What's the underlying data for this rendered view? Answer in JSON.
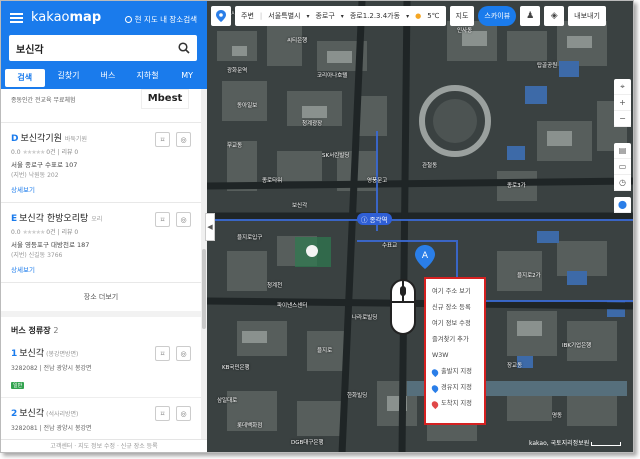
{
  "header": {
    "logo_text": "kakao",
    "logo_bold": "map",
    "scope_label": "현 지도 내 장소검색",
    "search_value": "보신각"
  },
  "tabs": [
    {
      "label": "검색",
      "active": true
    },
    {
      "label": "길찾기",
      "active": false
    },
    {
      "label": "버스",
      "active": false
    },
    {
      "label": "지하철",
      "active": false
    },
    {
      "label": "MY",
      "active": false
    }
  ],
  "partial_item": {
    "text": "종동인간 전교육 무료체험",
    "ad_text": "Mbest"
  },
  "places": [
    {
      "idx": "D",
      "name": "보신각기원",
      "category": "바둑기원",
      "rating": "0.0",
      "stars": "★★★★★",
      "reviews_a": "0건",
      "reviews_b": "리뷰 0",
      "addr": "서울 종로구 수표로 107",
      "jibun": "(지번) 낙원동 202",
      "detail": "상세보기"
    },
    {
      "idx": "E",
      "name": "보신각 한방오리탕",
      "category": "오리",
      "rating": "0.0",
      "stars": "★★★★★",
      "reviews_a": "0건",
      "reviews_b": "리뷰 0",
      "addr": "서울 영등포구 대방천로 187",
      "jibun": "(지번) 신길동 3766",
      "detail": "상세보기"
    }
  ],
  "more_label": "장소 더보기",
  "bus_section": {
    "title": "버스 정류장",
    "count": "2"
  },
  "bus_stops": [
    {
      "idx": "1",
      "name": "보신각",
      "category": "(봉강면방면)",
      "sub": "3282082  |  전남 광양시 봉강면",
      "badge": "일반"
    },
    {
      "idx": "2",
      "name": "보신각",
      "category": "(석사리방면)",
      "sub": "3282081  |  전남 광양시 봉강면",
      "badge": "일반"
    }
  ],
  "footer_text": "고객센터 · 지도 정보 수정 · 신규 장소 등록",
  "topbar": {
    "around": "주변",
    "city": "서울특별시",
    "district": "종로구",
    "dong": "종로1.2.3.4가동",
    "weather": "5℃",
    "map_btn": "지도",
    "sky_btn": "스카이뷰",
    "save_btn": "내보내기"
  },
  "context_menu": {
    "items": [
      "여기 주소 보기",
      "신규 장소 등록",
      "여기 정보 수정",
      "즐겨찾기 추가",
      "W3W"
    ],
    "pins": [
      {
        "label": "출발지 지정",
        "color": "#2a7ee8"
      },
      {
        "label": "경유지 지정",
        "color": "#2a7ee8"
      },
      {
        "label": "도착지 지정",
        "color": "#e04848"
      }
    ]
  },
  "map": {
    "station_label": "종각역",
    "marker_letter": "A",
    "copyright": "kakao, 국토지리정보원",
    "labels": [
      "서울시민청",
      "씨티은행",
      "광화문역",
      "코리아나호텔",
      "동아일보",
      "청계광장",
      "무교동",
      "SK서린빌딩",
      "종로타워",
      "영풍문고",
      "보신각",
      "나라로빌딩",
      "을지로입구",
      "청계천",
      "파이낸스센터",
      "DGB대구은행",
      "롯데백화점",
      "을지로",
      "KB국민은행",
      "종로3가",
      "인사동",
      "탑골공원",
      "관철동",
      "수표교",
      "삼일대로",
      "을지로2가",
      "장교동",
      "명동",
      "한화빌딩",
      "IBK기업은행"
    ]
  },
  "colors": {
    "brand": "#1a7bec",
    "highlight_border": "#d52121"
  }
}
